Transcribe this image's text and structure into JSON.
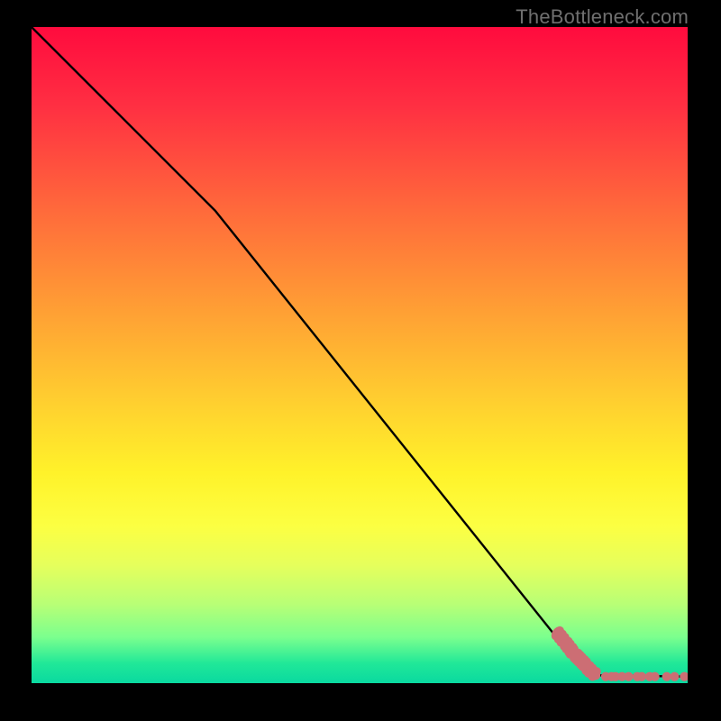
{
  "watermark": "TheBottleneck.com",
  "chart_data": {
    "type": "line",
    "title": "",
    "xlabel": "",
    "ylabel": "",
    "xlim": [
      0,
      100
    ],
    "ylim": [
      0,
      100
    ],
    "grid": false,
    "legend": null,
    "series": [
      {
        "name": "bottleneck-curve",
        "x": [
          0,
          28,
          82,
          86,
          100
        ],
        "y": [
          100,
          72,
          4.5,
          1.2,
          1.0
        ]
      }
    ],
    "scatter": {
      "name": "measured-points",
      "color": "#cc6e74",
      "points": [
        {
          "x": 80.2,
          "y": 7.6
        },
        {
          "x": 80.6,
          "y": 7.1
        },
        {
          "x": 81.0,
          "y": 6.6
        },
        {
          "x": 81.5,
          "y": 6.0
        },
        {
          "x": 81.8,
          "y": 5.6
        },
        {
          "x": 82.2,
          "y": 5.1
        },
        {
          "x": 82.4,
          "y": 4.8
        },
        {
          "x": 83.0,
          "y": 4.2
        },
        {
          "x": 83.3,
          "y": 3.9
        },
        {
          "x": 83.6,
          "y": 3.6
        },
        {
          "x": 84.0,
          "y": 3.2
        },
        {
          "x": 84.3,
          "y": 2.9
        },
        {
          "x": 84.8,
          "y": 2.3
        },
        {
          "x": 85.2,
          "y": 1.9
        },
        {
          "x": 85.8,
          "y": 1.4
        },
        {
          "x": 86.0,
          "y": 1.2
        },
        {
          "x": 87.5,
          "y": 1.0
        },
        {
          "x": 88.4,
          "y": 1.0
        },
        {
          "x": 89.0,
          "y": 1.0
        },
        {
          "x": 90.0,
          "y": 1.0
        },
        {
          "x": 91.0,
          "y": 1.0
        },
        {
          "x": 92.3,
          "y": 1.0
        },
        {
          "x": 93.0,
          "y": 1.0
        },
        {
          "x": 94.2,
          "y": 1.0
        },
        {
          "x": 95.0,
          "y": 1.0
        },
        {
          "x": 96.8,
          "y": 1.0
        },
        {
          "x": 98.0,
          "y": 1.0
        },
        {
          "x": 99.5,
          "y": 1.0
        }
      ]
    },
    "note": "No axis tick labels are visible in the source image; x/y values are estimated on a 0-100 normalized scale based on pixel positions."
  }
}
